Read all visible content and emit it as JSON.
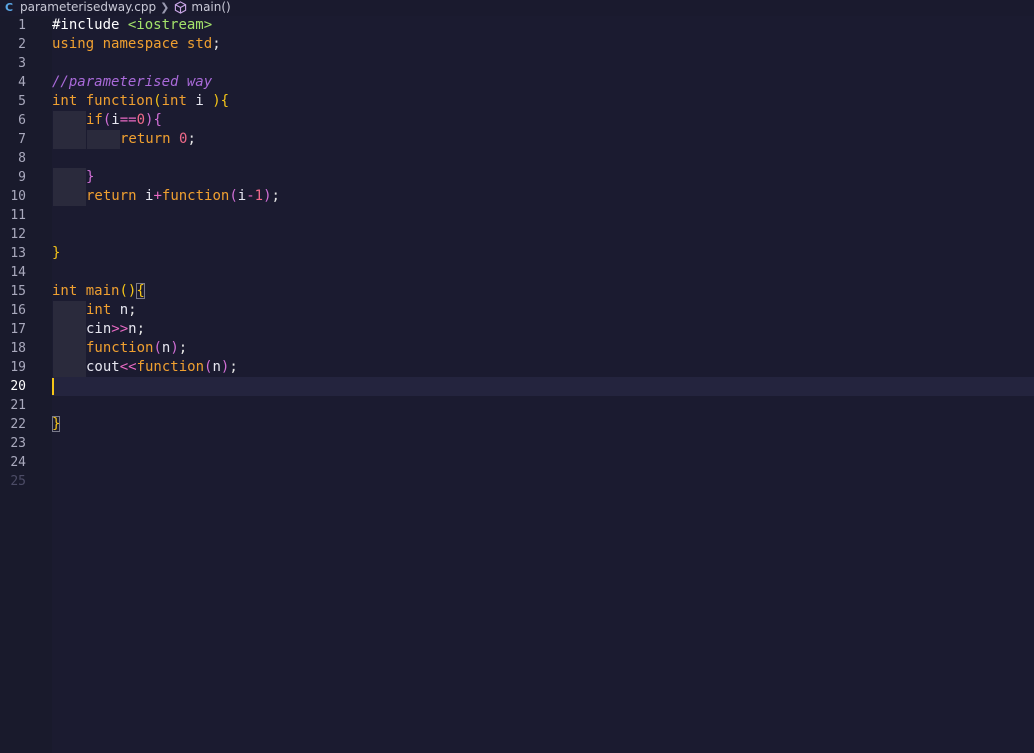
{
  "breadcrumb": {
    "file_icon": "C++",
    "file": "parameterisedway.cpp",
    "symbol": "main()",
    "symbol_icon": "cube-icon"
  },
  "editor": {
    "line_numbers": [
      "1",
      "2",
      "3",
      "4",
      "5",
      "6",
      "7",
      "8",
      "9",
      "10",
      "11",
      "12",
      "13",
      "14",
      "15",
      "16",
      "17",
      "18",
      "19",
      "20",
      "21",
      "22",
      "23",
      "24",
      "25"
    ],
    "current_line": "20",
    "code": {
      "l1": [
        "#include",
        " ",
        "<iostream>"
      ],
      "l2": [
        "using",
        " ",
        "namespace",
        " ",
        "std",
        ";"
      ],
      "l4": [
        "//parameterised way"
      ],
      "l5": [
        "int",
        " ",
        "function",
        "(",
        "int",
        " i ",
        ")",
        "{"
      ],
      "l6": [
        "if",
        "(",
        "i",
        "==",
        "0",
        ")",
        "{"
      ],
      "l7": [
        "return",
        " ",
        "0",
        ";"
      ],
      "l9": [
        "}"
      ],
      "l10": [
        "return",
        " ",
        "i",
        "+",
        "function",
        "(",
        "i",
        "-",
        "1",
        ")",
        ";"
      ],
      "l13": [
        "}"
      ],
      "l15": [
        "int",
        " ",
        "main",
        "()",
        "{"
      ],
      "l16": [
        "int",
        " n",
        ";"
      ],
      "l17": [
        "cin",
        ">>",
        "n",
        ";"
      ],
      "l18": [
        "function",
        "(",
        "n",
        ")",
        ";"
      ],
      "l19": [
        "cout",
        "<<",
        "function",
        "(",
        "n",
        ")",
        ";"
      ],
      "l22": [
        "}"
      ]
    }
  },
  "colors": {
    "background": "#1b1b30",
    "keyword": "#f0a030",
    "comment": "#a96ad9",
    "include_path": "#a3e26a",
    "number": "#f06a8a",
    "cursor": "#f5c518"
  }
}
